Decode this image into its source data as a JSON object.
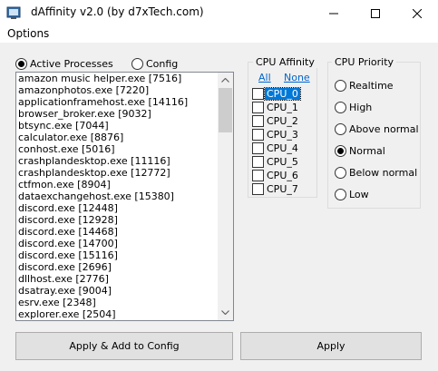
{
  "window": {
    "title": "dAffinity  v2.0 (by d7xTech.com)"
  },
  "menu": {
    "items": [
      "Options"
    ]
  },
  "mode": {
    "active_processes_label": "Active Processes",
    "config_label": "Config",
    "selected": "Active Processes"
  },
  "processes": [
    "amazon music helper.exe  [7516]",
    "amazonphotos.exe  [7220]",
    "applicationframehost.exe  [14116]",
    "browser_broker.exe  [9032]",
    "btsync.exe  [7044]",
    "calculator.exe  [8876]",
    "conhost.exe  [5016]",
    "crashplandesktop.exe  [11116]",
    "crashplandesktop.exe  [12772]",
    "ctfmon.exe  [8904]",
    "dataexchangehost.exe  [15380]",
    "discord.exe  [12448]",
    "discord.exe  [12928]",
    "discord.exe  [14468]",
    "discord.exe  [14700]",
    "discord.exe  [15116]",
    "discord.exe  [2696]",
    "dllhost.exe  [2776]",
    "dsatray.exe  [9004]",
    "esrv.exe  [2348]",
    "explorer.exe  [2504]"
  ],
  "affinity": {
    "title": "CPU Affinity",
    "all_label": "All",
    "none_label": "None",
    "cpus": [
      "CPU_0",
      "CPU_1",
      "CPU_2",
      "CPU_3",
      "CPU_4",
      "CPU_5",
      "CPU_6",
      "CPU_7"
    ],
    "selected_cpu": "CPU_0"
  },
  "priority": {
    "title": "CPU Priority",
    "options": [
      "Realtime",
      "High",
      "Above normal",
      "Normal",
      "Below normal",
      "Low"
    ],
    "selected": "Normal"
  },
  "buttons": {
    "apply_add_config": "Apply & Add to Config",
    "apply": "Apply"
  }
}
